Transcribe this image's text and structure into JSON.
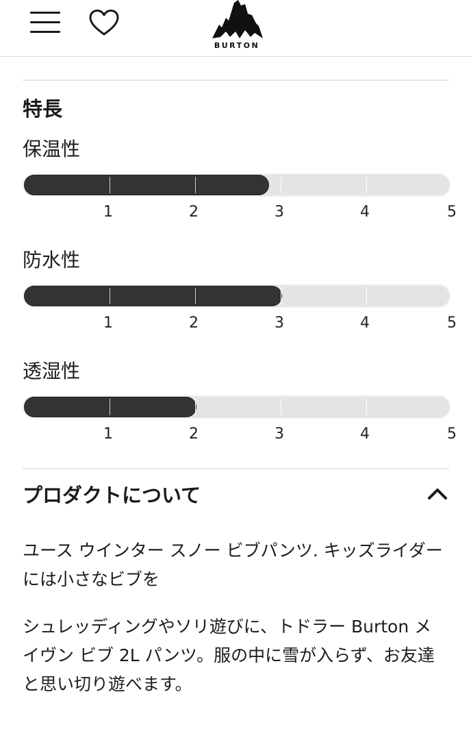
{
  "header": {
    "menu_icon": "hamburger-menu-icon",
    "favorite_icon": "heart-icon",
    "logo_text": "BURTON"
  },
  "features": {
    "title": "特長",
    "scale_labels": [
      "1",
      "2",
      "3",
      "4",
      "5"
    ],
    "items": [
      {
        "label": "保温性",
        "value": 2.85
      },
      {
        "label": "防水性",
        "value": 3.0
      },
      {
        "label": "透湿性",
        "value": 2.0
      }
    ]
  },
  "about": {
    "title": "プロダクトについて",
    "toggle_icon": "chevron-up-icon",
    "paragraph1": "ユース ウインター スノー ビブパンツ. キッズライダーには小さなビブを",
    "paragraph2": "シュレッディングやソリ遊びに、トドラー Burton メイヴン ビブ 2L パンツ。服の中に雪が入らず、お友達と思い切り遊べます。"
  },
  "colors": {
    "bar_fill": "#333333",
    "bar_track": "#e4e4e4",
    "divider": "#e6e6e6"
  }
}
